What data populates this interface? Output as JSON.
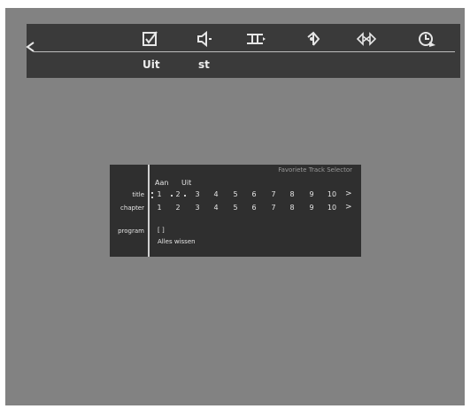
{
  "menu": {
    "icons": [
      "check-icon",
      "speaker-icon",
      "subtitle-icon",
      "angle-icon",
      "repeat-icon",
      "clock-icon"
    ],
    "labels": [
      "Uit",
      "st"
    ]
  },
  "panel": {
    "title": "Favoriete Track Selector",
    "col_headers": [
      "Aan",
      "Uit"
    ],
    "title_label": "title",
    "chapter_label": "chapter",
    "program_label": "program",
    "title_numbers": [
      "1",
      "2",
      "3",
      "4",
      "5",
      "6",
      "7",
      "8",
      "9",
      "10"
    ],
    "chapter_numbers": [
      "1",
      "2",
      "3",
      "4",
      "5",
      "6",
      "7",
      "8",
      "9",
      "10"
    ],
    "program_value": "[ ]",
    "clear_all": "Alles wissen",
    "next_symbol": ">"
  }
}
